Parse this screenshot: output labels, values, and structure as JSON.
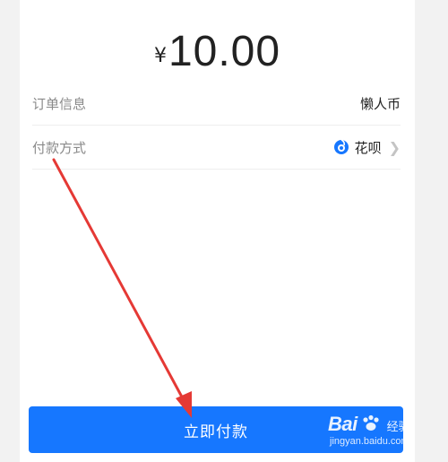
{
  "payment": {
    "currency_symbol": "¥",
    "amount": "10.00"
  },
  "order_info": {
    "label": "订单信息",
    "value": "懒人币"
  },
  "payment_method": {
    "label": "付款方式",
    "value": "花呗",
    "icon": "huabei-icon",
    "chevron": "chevron-right-icon"
  },
  "pay_button": {
    "label": "立即付款"
  },
  "watermark": {
    "brand": "Bai",
    "brand_suffix": "经验",
    "url": "jingyan.baidu.com"
  },
  "colors": {
    "primary": "#1677ff",
    "annotation_arrow": "#e53935"
  }
}
